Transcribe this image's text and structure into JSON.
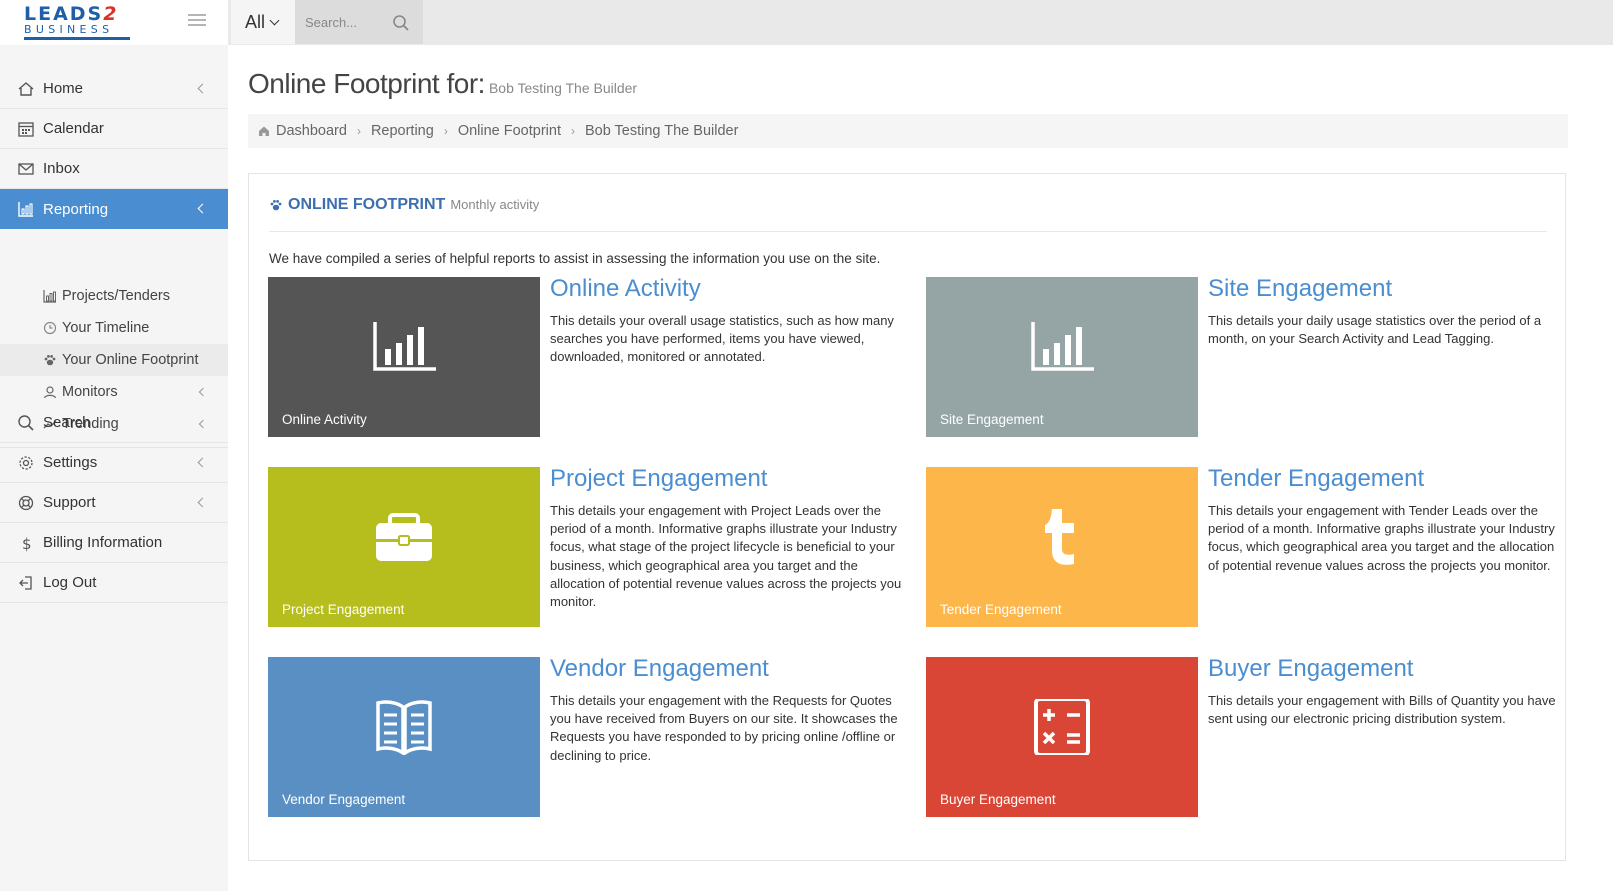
{
  "app": {
    "logo_line1": "LEADS",
    "logo_two": "2",
    "logo_line2": "BUSINESS"
  },
  "topbar": {
    "scope_label": "All",
    "search_placeholder": "Search..."
  },
  "sidebar": {
    "items": [
      {
        "label": "Home",
        "icon": "home-icon",
        "has_arrow": true
      },
      {
        "label": "Calendar",
        "icon": "calendar-icon",
        "has_arrow": false
      },
      {
        "label": "Inbox",
        "icon": "envelope-icon",
        "has_arrow": false
      },
      {
        "label": "Reporting",
        "icon": "bar-chart-icon",
        "has_arrow": true,
        "active": true
      },
      {
        "label": "Search",
        "icon": "search-icon",
        "has_arrow": false
      },
      {
        "label": "Settings",
        "icon": "gear-icon",
        "has_arrow": true
      },
      {
        "label": "Support",
        "icon": "lifebuoy-icon",
        "has_arrow": true
      },
      {
        "label": "Billing Information",
        "icon": "dollar-icon",
        "has_arrow": false
      },
      {
        "label": "Log Out",
        "icon": "logout-icon",
        "has_arrow": false
      }
    ],
    "sub_items": [
      {
        "label": "Projects/Tenders",
        "icon": "bar-chart-icon"
      },
      {
        "label": "Your Timeline",
        "icon": "clock-icon"
      },
      {
        "label": "Your Online Footprint",
        "icon": "paw-icon",
        "current": true
      },
      {
        "label": "Monitors",
        "icon": "user-icon",
        "has_arrow": true
      },
      {
        "label": "Trending",
        "icon": "trend-line-icon",
        "has_arrow": true
      }
    ]
  },
  "page": {
    "title": "Online Footprint for:",
    "subject": "Bob Testing The Builder"
  },
  "breadcrumb": [
    "Dashboard",
    "Reporting",
    "Online Footprint",
    "Bob Testing The Builder"
  ],
  "panel": {
    "title": "ONLINE FOOTPRINT",
    "subtitle": "Monthly activity",
    "intro": "We have compiled a series of helpful reports to assist in assessing the information you use on the site."
  },
  "cards": [
    {
      "tile_label": "Online Activity",
      "title": "Online Activity",
      "color": "#555555",
      "icon": "bar-chart-icon",
      "description": "This details your overall usage statistics, such as how many searches you have performed, items you have viewed, downloaded, monitored or annotated."
    },
    {
      "tile_label": "Site Engagement",
      "title": "Site Engagement",
      "color": "#95a5a6",
      "icon": "bar-chart-icon",
      "description": "This details your daily usage statistics over the period of a month, on your Search Activity and Lead Tagging."
    },
    {
      "tile_label": "Project Engagement",
      "title": "Project Engagement",
      "color": "#b5be1c",
      "icon": "briefcase-icon",
      "description": "This details your engagement with Project Leads over the period of a month. Informative graphs illustrate your Industry focus, what stage of the project lifecycle is beneficial to your business, which geographical area you target and the allocation of potential revenue values across the projects you monitor."
    },
    {
      "tile_label": "Tender Engagement",
      "title": "Tender Engagement",
      "color": "#fdb64a",
      "icon": "tumblr-t-icon",
      "description": "This details your engagement with Tender Leads over the period of a month. Informative graphs illustrate your Industry focus, which geographical area you target and the allocation of potential revenue values across the projects you monitor."
    },
    {
      "tile_label": "Vendor Engagement",
      "title": "Vendor Engagement",
      "color": "#5a8fc3",
      "icon": "book-icon",
      "description": "This details your engagement with the Requests for Quotes you have received from Buyers on our site. It showcases the Requests you have responded to by pricing online /offline or declining to price."
    },
    {
      "tile_label": "Buyer Engagement",
      "title": "Buyer Engagement",
      "color": "#d94636",
      "icon": "calculator-icon",
      "description": "This details your engagement with Bills of Quantity you have sent using our electronic pricing distribution system."
    }
  ]
}
